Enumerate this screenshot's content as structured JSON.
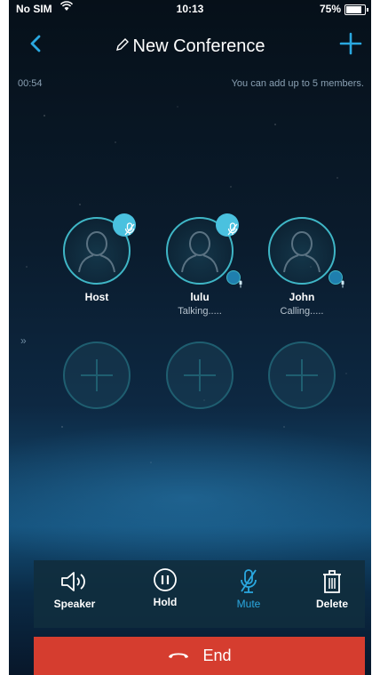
{
  "status_bar": {
    "carrier": "No SIM",
    "time": "10:13",
    "battery": "75%"
  },
  "nav": {
    "title": "New Conference"
  },
  "info": {
    "timer": "00:54",
    "hint": "You can add up to 5 members."
  },
  "members": [
    {
      "name": "Host",
      "status": ""
    },
    {
      "name": "lulu",
      "status": "Talking....."
    },
    {
      "name": "John",
      "status": "Calling....."
    }
  ],
  "controls": {
    "speaker": "Speaker",
    "hold": "Hold",
    "mute": "Mute",
    "delete": "Delete"
  },
  "end_button": {
    "label": "End"
  },
  "colors": {
    "accent": "#2aa8e0",
    "end": "#d53d2f",
    "ring": "#3fb6c6"
  }
}
